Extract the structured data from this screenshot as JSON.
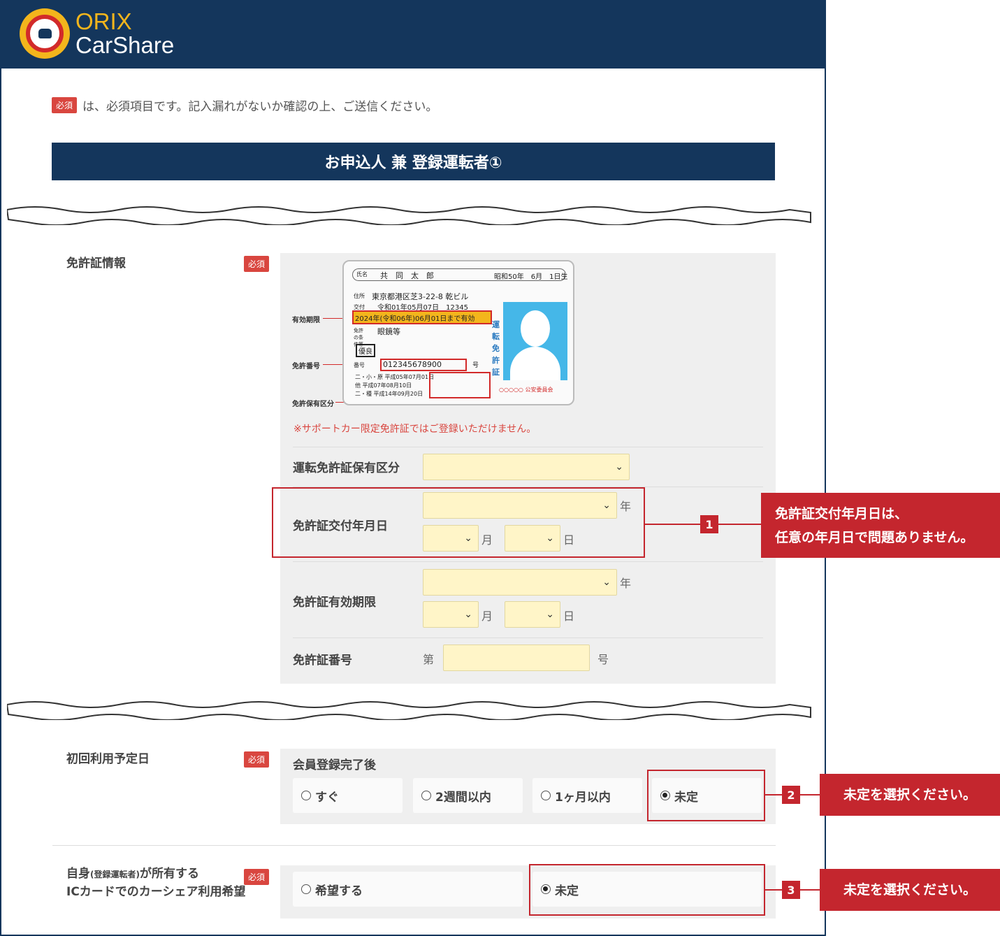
{
  "brand": {
    "line1": "ORIX",
    "line2": "CarShare"
  },
  "notice": {
    "badge": "必須",
    "text": "は、必須項目です。記入漏れがないか確認の上、ご送信ください。"
  },
  "section_title": "お申込人 兼 登録運転者①",
  "license_info": {
    "label": "免許証情報",
    "required": "必須",
    "sample_card": {
      "name_tag": "氏名",
      "name": "共　同　太　郎",
      "birth": "昭和50年　6月　1日生",
      "address_tag": "住所",
      "address": "東京都港区芝3-22-8 乾ビル",
      "issued_tag": "交付",
      "issued": "令和01年05月07日　12345",
      "expiry": "2024年(令和06年)06月01日まで有効",
      "conditions_tag": "免許の条件等",
      "conditions": "眼鏡等",
      "grade": "優良",
      "number_tag": "番号",
      "number": "012345678900",
      "number_suffix": "号",
      "history": [
        "二・小・原 平成05年07月01日",
        "他 平成07年08月10日",
        "二・種 平成14年09月20日"
      ],
      "vertical_title": "運転免許証",
      "commission": "○○○○○ 公安委員会"
    },
    "callouts": {
      "expiry": "有効期限",
      "number": "免許番号",
      "category": "免許保有区分"
    },
    "note": "※サポートカー限定免許証ではご登録いただけません。",
    "fields": {
      "holding_category": "運転免許証保有区分",
      "issue_date": "免許証交付年月日",
      "expiry_date": "免許証有効期限",
      "license_number": "免許証番号"
    },
    "units": {
      "year": "年",
      "month": "月",
      "day": "日",
      "number_prefix": "第",
      "number_suffix": "号"
    }
  },
  "first_use": {
    "label": "初回利用予定日",
    "required": "必須",
    "subhead": "会員登録完了後",
    "options": [
      "すぐ",
      "2週間以内",
      "1ヶ月以内",
      "未定"
    ],
    "selected": "未定"
  },
  "ic_card": {
    "label_line1_a": "自身",
    "label_line1_small": "(登録運転者)",
    "label_line1_b": "が所有する",
    "label_line2": "ICカードでのカーシェア利用希望",
    "required": "必須",
    "options": [
      "希望する",
      "未定"
    ],
    "selected": "未定"
  },
  "annotations": [
    {
      "num": "1",
      "line1": "免許証交付年月日は、",
      "line2": "任意の年月日で問題ありません。"
    },
    {
      "num": "2",
      "text": "未定を選択ください。"
    },
    {
      "num": "3",
      "text": "未定を選択ください。"
    }
  ],
  "colors": {
    "navy": "#14365c",
    "accent_red": "#c4262e",
    "badge_red": "#d9463f",
    "input_yellow": "#fff5c8",
    "logo_gold": "#f3b51c"
  }
}
